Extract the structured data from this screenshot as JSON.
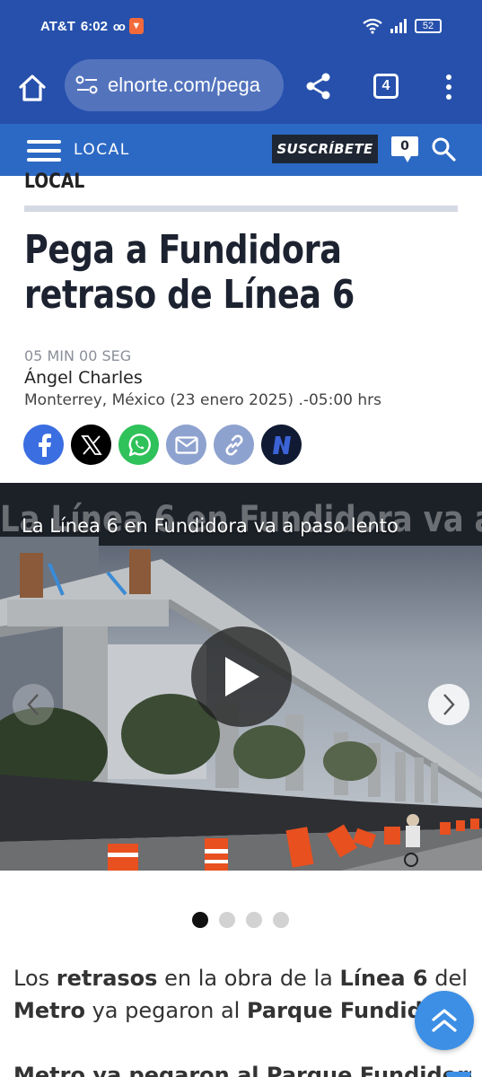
{
  "status_bar": {
    "carrier": "AT&T",
    "time": "6:02",
    "voicemail_icon": "voicemail-icon",
    "battery": "52"
  },
  "browser": {
    "url": "elnorte.com/pega",
    "tab_count": "4"
  },
  "site_header": {
    "section": "LOCAL",
    "subscribe_label": "SUSCRÍBETE",
    "notification_count": "0"
  },
  "article": {
    "kicker": "LOCAL",
    "headline": "Pega a Fundidora retraso de Línea 6",
    "read_time": "05 MIN 00 SEG",
    "author": "Ángel Charles",
    "dateline": "Monterrey, México (23 enero 2025) .-05:00 hrs",
    "share_buttons": [
      {
        "name": "facebook",
        "color": "#3b6ee0"
      },
      {
        "name": "x",
        "color": "#000000"
      },
      {
        "name": "whatsapp",
        "color": "#2fc15a"
      },
      {
        "name": "email",
        "color": "#8ea2cf"
      },
      {
        "name": "copy-link",
        "color": "#8ea2cf"
      },
      {
        "name": "n",
        "color": "#111a33"
      }
    ],
    "media": {
      "caption": "La Línea 6 en Fundidora va a paso lento",
      "slide_count": 4,
      "active_slide": 1
    },
    "body_paragraph_parts": [
      {
        "text": "Los ",
        "bold": false
      },
      {
        "text": "retrasos",
        "bold": true
      },
      {
        "text": " en la obra de la ",
        "bold": false
      },
      {
        "text": "Línea 6",
        "bold": true
      },
      {
        "text": " del ",
        "bold": false
      },
      {
        "text": "Metro",
        "bold": true
      },
      {
        "text": " ya pegaron al ",
        "bold": false
      },
      {
        "text": "Parque Fundidora",
        "bold": true
      },
      {
        "text": ".",
        "bold": false
      }
    ],
    "body_repeat_line": "Metro ya pegaron al Parque Fundidora."
  },
  "colors": {
    "browser_blue": "#2650ac",
    "site_blue": "#2c69c4",
    "accent_blue": "#3d8fe5"
  }
}
